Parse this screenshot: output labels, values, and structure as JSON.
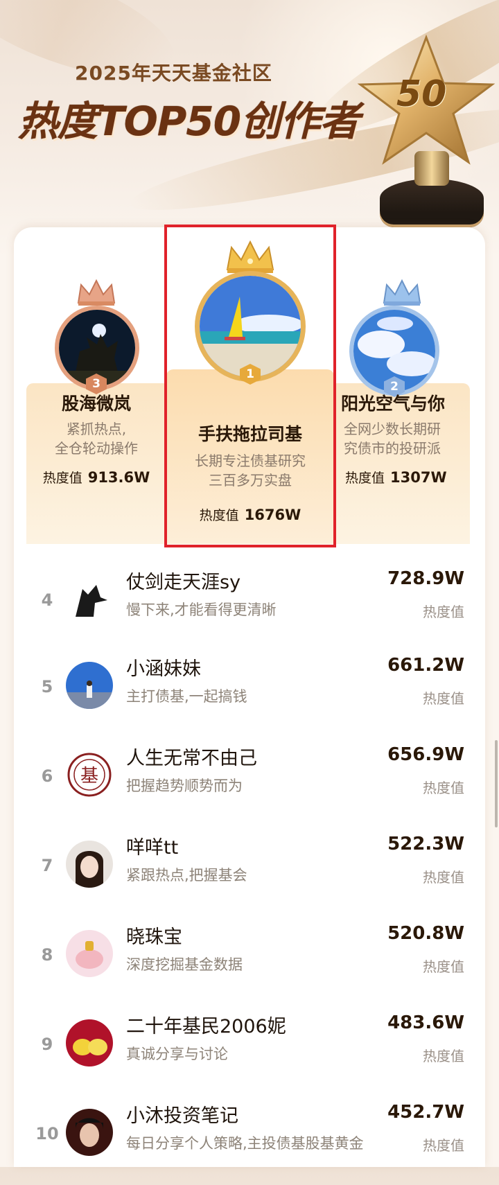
{
  "header": {
    "subtitle": "2025年天天基金社区",
    "title": "热度TOP50创作者",
    "trophy_number": "50"
  },
  "podium": [
    {
      "rank": "3",
      "name": "股海微岚",
      "desc1": "紧抓热点,",
      "desc2": "全仓轮动操作",
      "heat_label": "热度值",
      "heat_value": "913.6W"
    },
    {
      "rank": "1",
      "name": "手扶拖拉司基",
      "desc1": "长期专注债基研究",
      "desc2": "三百多万实盘",
      "heat_label": "热度值",
      "heat_value": "1676W"
    },
    {
      "rank": "2",
      "name": "阳光空气与你",
      "desc1": "全网少数长期研",
      "desc2": "究债市的投研派",
      "heat_label": "热度值",
      "heat_value": "1307W"
    }
  ],
  "list": [
    {
      "rank": "4",
      "name": "仗剑走天涯sy",
      "desc": "慢下来,才能看得更清晰",
      "value": "728.9W",
      "unit": "热度值"
    },
    {
      "rank": "5",
      "name": "小涵妹妹",
      "desc": "主打债基,一起搞钱",
      "value": "661.2W",
      "unit": "热度值"
    },
    {
      "rank": "6",
      "name": "人生无常不由己",
      "desc": "把握趋势顺势而为",
      "value": "656.9W",
      "unit": "热度值"
    },
    {
      "rank": "7",
      "name": "咩咩tt",
      "desc": "紧跟热点,把握基会",
      "value": "522.3W",
      "unit": "热度值"
    },
    {
      "rank": "8",
      "name": "晓珠宝",
      "desc": "深度挖掘基金数据",
      "value": "520.8W",
      "unit": "热度值"
    },
    {
      "rank": "9",
      "name": "二十年基民2006妮",
      "desc": "真诚分享与讨论",
      "value": "483.6W",
      "unit": "热度值"
    },
    {
      "rank": "10",
      "name": "小沐投资笔记",
      "desc": "每日分享个人策略,主投债基股基黄金",
      "value": "452.7W",
      "unit": "热度值"
    }
  ],
  "avatar_seal_text": "基",
  "colors": {
    "gold": "#d9a441",
    "bronze": "#d98a62",
    "silver": "#8fb3e0",
    "highlight_border": "#e0222a",
    "title_brown": "#6b3212"
  }
}
